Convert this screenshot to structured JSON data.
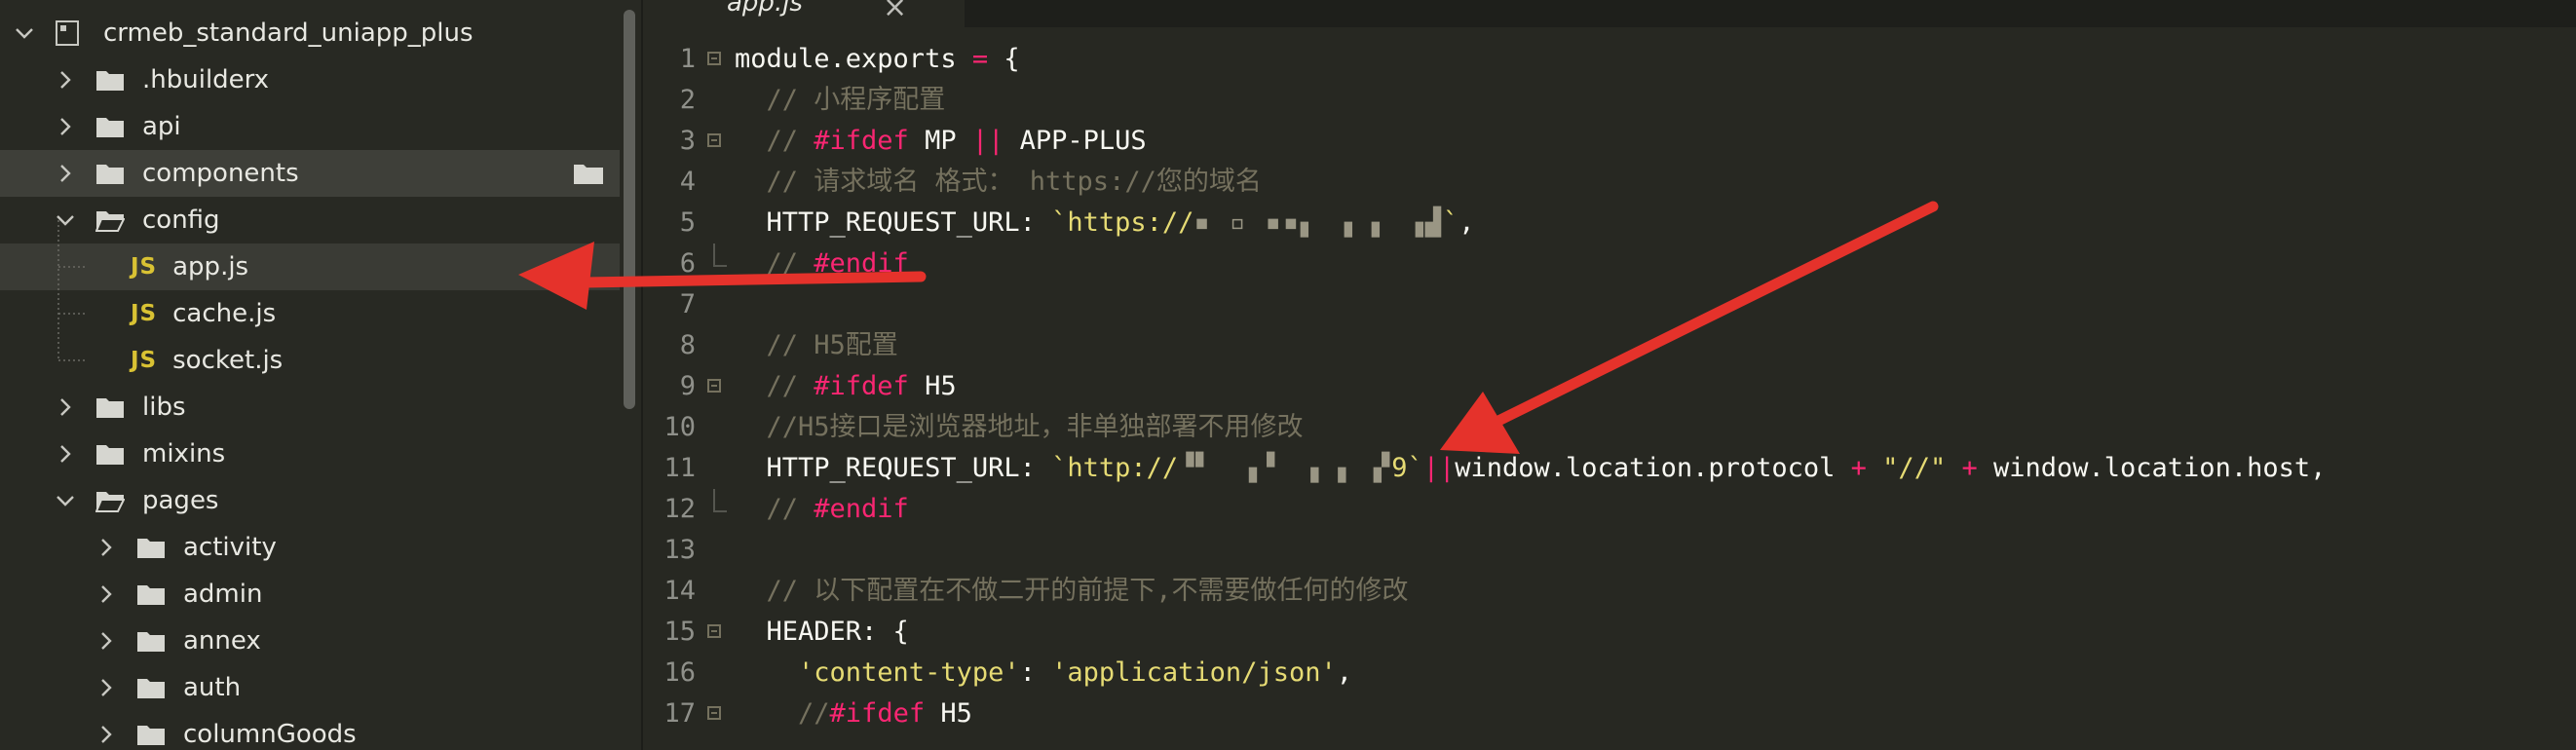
{
  "sidebar": {
    "project": "crmeb_standard_uniapp_plus",
    "items": [
      {
        "label": ".hbuilderx",
        "type": "folder",
        "expanded": false
      },
      {
        "label": "api",
        "type": "folder",
        "expanded": false
      },
      {
        "label": "components",
        "type": "folder",
        "expanded": false
      },
      {
        "label": "config",
        "type": "folder",
        "expanded": true
      },
      {
        "label": "app.js",
        "type": "js-file"
      },
      {
        "label": "cache.js",
        "type": "js-file"
      },
      {
        "label": "socket.js",
        "type": "js-file"
      },
      {
        "label": "libs",
        "type": "folder",
        "expanded": false
      },
      {
        "label": "mixins",
        "type": "folder",
        "expanded": false
      },
      {
        "label": "pages",
        "type": "folder",
        "expanded": true
      },
      {
        "label": "activity",
        "type": "folder",
        "expanded": false
      },
      {
        "label": "admin",
        "type": "folder",
        "expanded": false
      },
      {
        "label": "annex",
        "type": "folder",
        "expanded": false
      },
      {
        "label": "auth",
        "type": "folder",
        "expanded": false
      },
      {
        "label": "columnGoods",
        "type": "folder",
        "expanded": false
      }
    ],
    "js_badge": "JS"
  },
  "tab": {
    "label": "app.js",
    "close": "×"
  },
  "editor": {
    "lines": [
      {
        "n": "1",
        "tokens": [
          [
            "def",
            "module.exports "
          ],
          [
            "kw",
            "="
          ],
          [
            "def",
            " {"
          ]
        ]
      },
      {
        "n": "2",
        "tokens": [
          [
            "com",
            "  // 小程序配置"
          ]
        ]
      },
      {
        "n": "3",
        "tokens": [
          [
            "com",
            "  // "
          ],
          [
            "kw",
            "#ifdef"
          ],
          [
            "def",
            " MP "
          ],
          [
            "kw",
            "||"
          ],
          [
            "def",
            " APP-PLUS"
          ]
        ]
      },
      {
        "n": "4",
        "tokens": [
          [
            "com",
            "  // 请求域名 格式： https://您的域名"
          ]
        ]
      },
      {
        "n": "5",
        "tokens": [
          [
            "def",
            "  HTTP_REQUEST_URL: "
          ],
          [
            "str",
            "`https://"
          ],
          [
            "blur",
            "▪ ▫ ▪▪▖ ▗ ▖ ▗▟"
          ],
          [
            "str",
            "`"
          ],
          [
            "def",
            ","
          ]
        ]
      },
      {
        "n": "6",
        "tokens": [
          [
            "com",
            "  // "
          ],
          [
            "kw",
            "#endif"
          ]
        ]
      },
      {
        "n": "7",
        "tokens": []
      },
      {
        "n": "8",
        "tokens": [
          [
            "com",
            "  // H5配置"
          ]
        ]
      },
      {
        "n": "9",
        "tokens": [
          [
            "com",
            "  // "
          ],
          [
            "kw",
            "#ifdef"
          ],
          [
            "def",
            " H5"
          ]
        ]
      },
      {
        "n": "10",
        "tokens": [
          [
            "com",
            "  //H5接口是浏览器地址，非单独部署不用修改"
          ]
        ]
      },
      {
        "n": "11",
        "tokens": [
          [
            "def",
            "  HTTP_REQUEST_URL: "
          ],
          [
            "str",
            "`http://"
          ],
          [
            "blur",
            "▝▘  ▖▘ ▗ ▖ ▞"
          ],
          [
            "str",
            "9`"
          ],
          [
            "kw",
            "||"
          ],
          [
            "def",
            "window.location.protocol "
          ],
          [
            "kw",
            "+"
          ],
          [
            "str",
            " \"//\" "
          ],
          [
            "kw",
            "+"
          ],
          [
            "def",
            " window.location.host,"
          ]
        ]
      },
      {
        "n": "12",
        "tokens": [
          [
            "com",
            "  // "
          ],
          [
            "kw",
            "#endif"
          ]
        ]
      },
      {
        "n": "13",
        "tokens": []
      },
      {
        "n": "14",
        "tokens": [
          [
            "com",
            "  // 以下配置在不做二开的前提下,不需要做任何的修改"
          ]
        ]
      },
      {
        "n": "15",
        "tokens": [
          [
            "def",
            "  HEADER: {"
          ]
        ]
      },
      {
        "n": "16",
        "tokens": [
          [
            "str",
            "    'content-type'"
          ],
          [
            "def",
            ": "
          ],
          [
            "str",
            "'application/json'"
          ],
          [
            "def",
            ","
          ]
        ]
      },
      {
        "n": "17",
        "tokens": [
          [
            "com",
            "    //"
          ],
          [
            "kw",
            "#ifdef"
          ],
          [
            "def",
            " H5"
          ]
        ]
      }
    ]
  },
  "colors": {
    "background": "#272822",
    "sidebar": "#282923",
    "keyword": "#f92672",
    "string": "#e6db74",
    "comment": "#75715e",
    "arrow": "#e5322b",
    "js_icon": "#d9c233"
  }
}
